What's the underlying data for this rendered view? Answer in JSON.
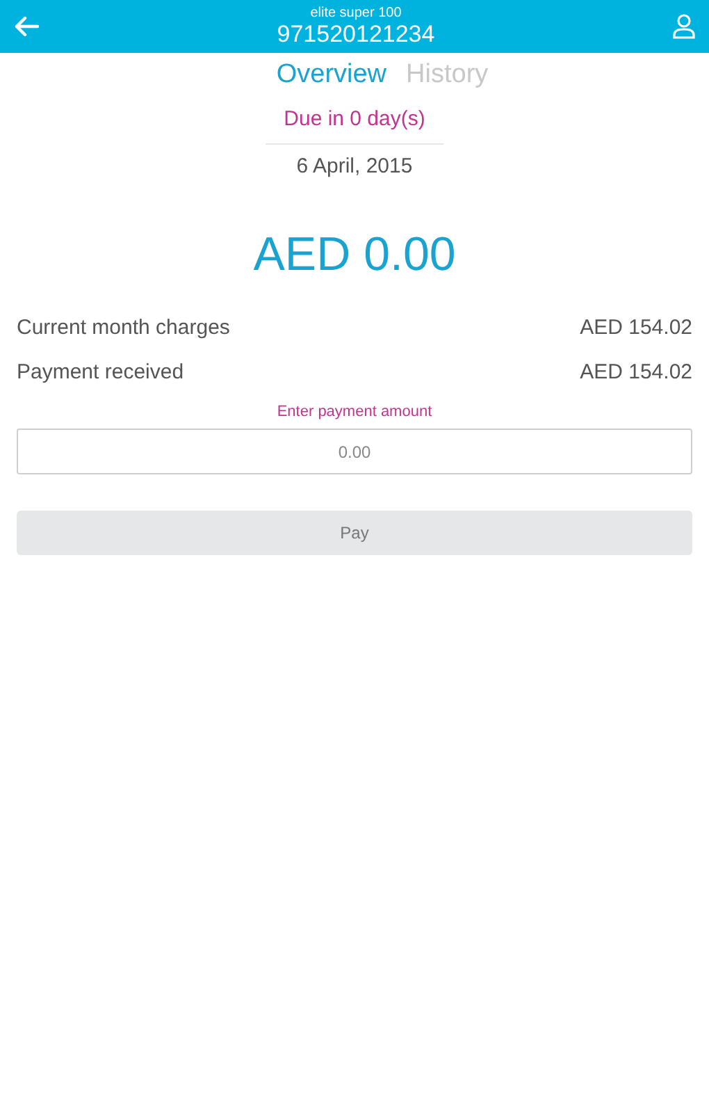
{
  "header": {
    "plan": "elite super 100",
    "number": "971520121234"
  },
  "tabs": [
    {
      "label": "Overview",
      "selected": true
    },
    {
      "label": "History",
      "selected": false
    }
  ],
  "due": "Due in 0 day(s)",
  "date": "6 April, 2015",
  "balance": "AED 0.00",
  "rows": [
    {
      "label": "Current month charges",
      "value": "AED 154.02"
    },
    {
      "label": "Payment received",
      "value": "AED 154.02"
    }
  ],
  "payment": {
    "label": "Enter payment amount",
    "placeholder": "0.00"
  },
  "pay_button": {
    "label": "Pay",
    "disabled": true
  }
}
